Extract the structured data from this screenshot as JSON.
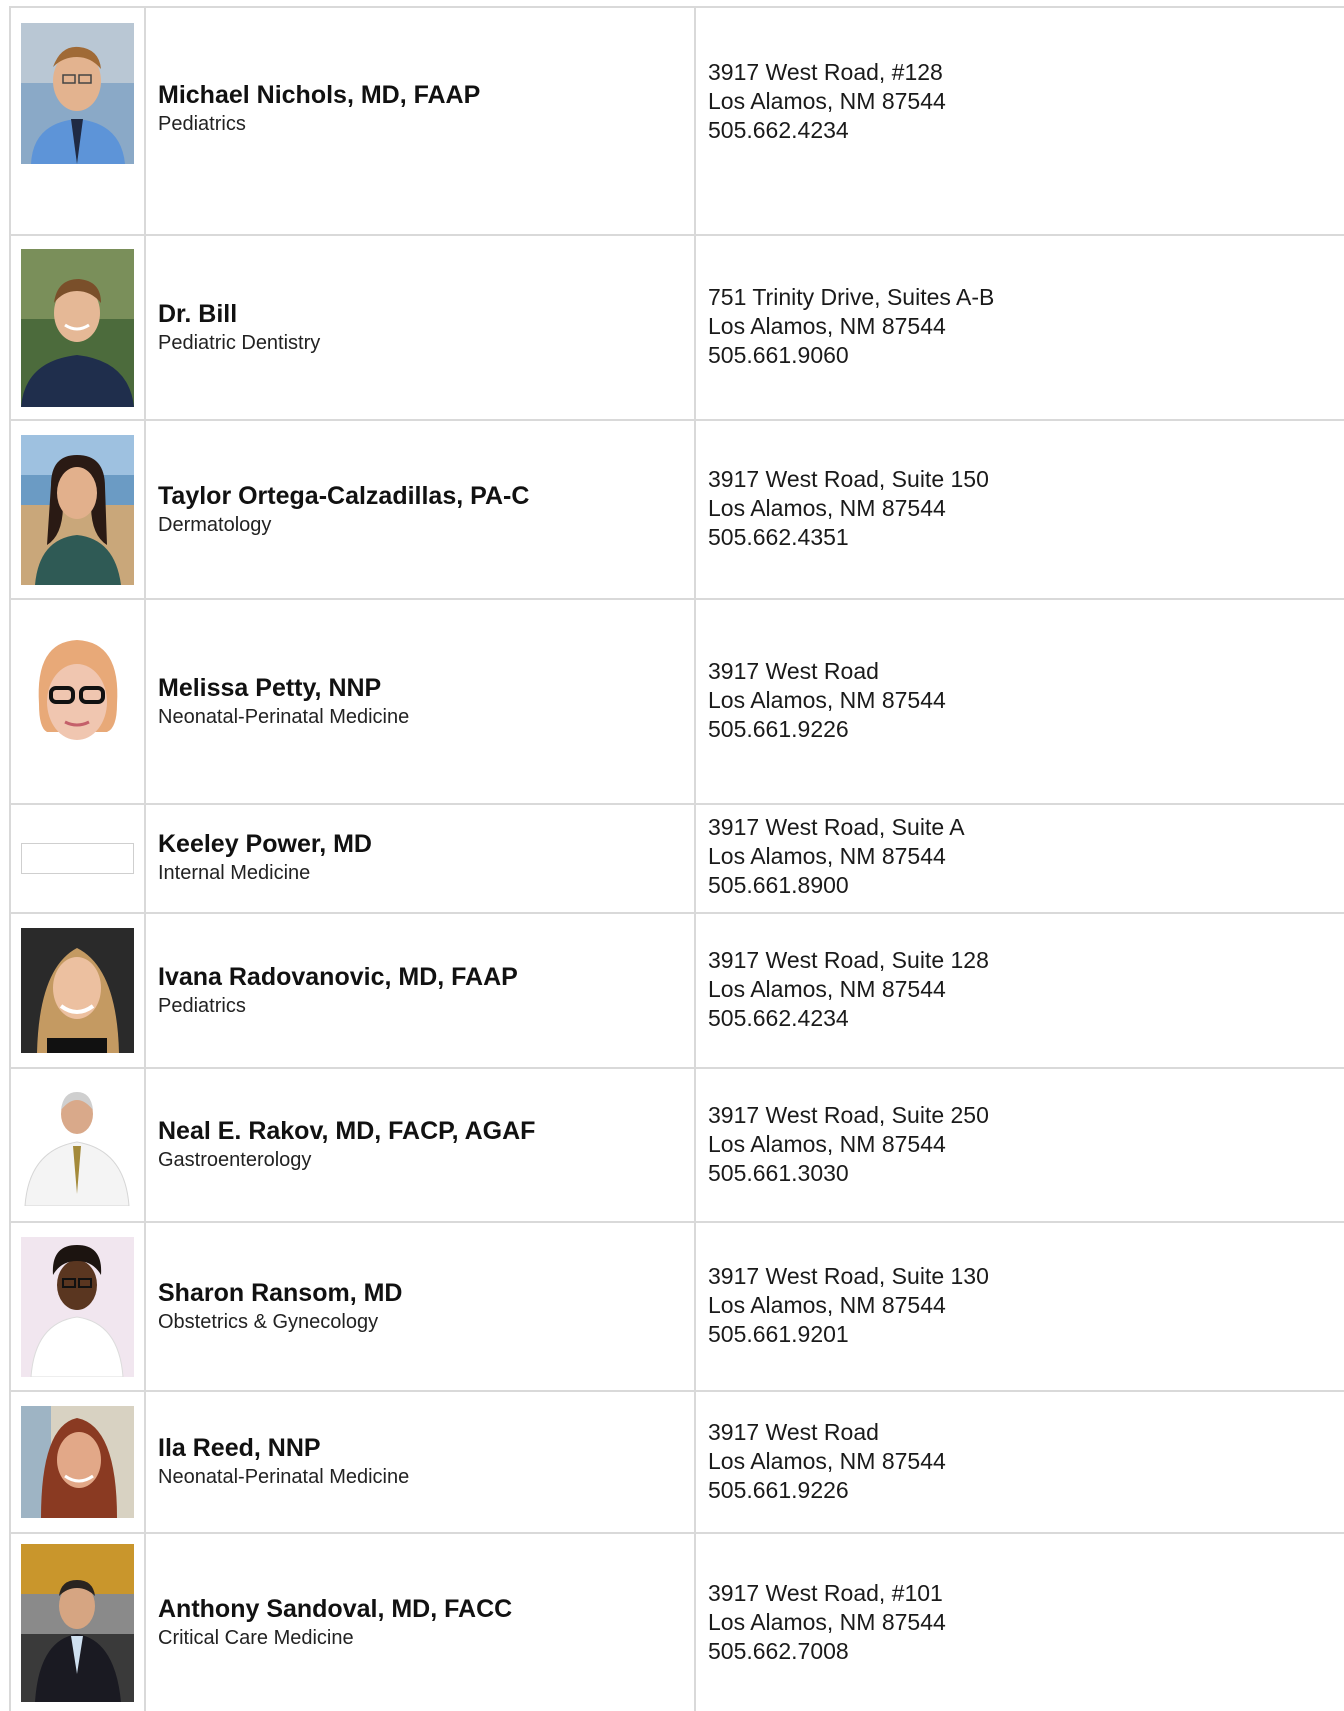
{
  "providers": [
    {
      "name": "Michael Nichols, MD, FAAP",
      "specialty": "Pediatrics",
      "address1": "3917 West Road, #128",
      "address2": "Los Alamos, NM 87544",
      "phone": "505.662.4234"
    },
    {
      "name": "Dr. Bill",
      "specialty": "Pediatric Dentistry",
      "address1": "751 Trinity Drive, Suites A-B",
      "address2": "Los Alamos, NM 87544",
      "phone": "505.661.9060"
    },
    {
      "name": "Taylor Ortega-Calzadillas, PA-C",
      "specialty": "Dermatology",
      "address1": "3917 West Road, Suite 150",
      "address2": "Los Alamos, NM 87544",
      "phone": "505.662.4351"
    },
    {
      "name": "Melissa Petty, NNP",
      "specialty": "Neonatal-Perinatal Medicine",
      "address1": "3917 West Road",
      "address2": "Los Alamos, NM 87544",
      "phone": "505.661.9226"
    },
    {
      "name": "Keeley Power, MD",
      "specialty": "Internal Medicine",
      "address1": "3917 West Road, Suite A",
      "address2": "Los Alamos, NM 87544",
      "phone": "505.661.8900"
    },
    {
      "name": "Ivana Radovanovic, MD, FAAP",
      "specialty": "Pediatrics",
      "address1": "3917 West Road, Suite 128",
      "address2": "Los Alamos, NM 87544",
      "phone": "505.662.4234"
    },
    {
      "name": "Neal E. Rakov, MD, FACP, AGAF",
      "specialty": "Gastroenterology",
      "address1": "3917 West Road, Suite 250",
      "address2": "Los Alamos, NM 87544",
      "phone": "505.661.3030"
    },
    {
      "name": "Sharon Ransom, MD",
      "specialty": "Obstetrics & Gynecology",
      "address1": "3917 West Road, Suite 130",
      "address2": "Los Alamos, NM 87544",
      "phone": "505.661.9201"
    },
    {
      "name": "Ila Reed, NNP",
      "specialty": "Neonatal-Perinatal Medicine",
      "address1": "3917 West Road",
      "address2": "Los Alamos, NM 87544",
      "phone": "505.661.9226"
    },
    {
      "name": "Anthony Sandoval, MD, FACC",
      "specialty": "Critical Care Medicine",
      "address1": "3917 West Road, #101",
      "address2": "Los Alamos, NM 87544",
      "phone": "505.662.7008"
    }
  ],
  "colors": {
    "border": "#d9d9d9",
    "text": "#111111"
  }
}
